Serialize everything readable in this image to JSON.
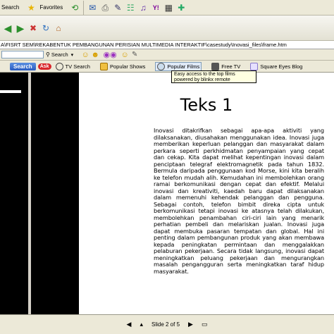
{
  "toolbar": {
    "search_label": "Search",
    "favorites_label": "Favorites"
  },
  "address": {
    "value": "A\\FISRT SEM\\REKABENTUK PEMBANGUNAN PERISIAN MULTIMEDIA INTERAKTIF\\casestudy\\Inovasi_files\\frame.htm"
  },
  "searchbar": {
    "search_label": "Search"
  },
  "linksbar": {
    "search_button": "Search",
    "ask_logo": "Ask",
    "items": [
      {
        "label": "TV Search",
        "icon": "magnifier-tv-icon"
      },
      {
        "label": "Popular Shows",
        "icon": "popular-shows-icon"
      },
      {
        "label": "Popular Films",
        "icon": "globe-icon"
      },
      {
        "label": "Free TV",
        "icon": "free-tv-icon"
      },
      {
        "label": "Square Eyes Blog",
        "icon": "square-eyes-icon"
      }
    ]
  },
  "tooltip": {
    "text": "Easy access to the top films powered by blinkx remote"
  },
  "slide": {
    "title": "Teks 1",
    "body": "Inovasi ditakrifkan sebagai apa-apa aktiviti yang dilaksanakan, diusahakan menggunakan idea. Inovasi juga memberikan keperluan pelanggan dan masyarakat dalam perkara seperti perkhidmatan penyampaian yang cepat dan cekap. Kita dapat melihat kepentingan inovasi dalam penciptaan telegraf elektromagnetik pada tahun 1832. Bermula daripada penggunaan kod Morse, kini kita beralih ke telefon mudah alih. Kemudahan ini membolehkan orang ramai berkomunikasi dengan cepat dan efektif. Melalui inovasi dan kreativiti, kaedah baru dapat dilaksanakan dalam memenuhi kehendak pelanggan dan pengguna. Sebagai contoh, telefon bimbit direka cipta untuk berkomunikasi tetapi inovasi ke atasnya telah dilakukan, membolehkan penambahan ciri-ciri lain yang menarik perhatian pembeli dan melariskan jualan. Inovasi juga dapat membuka pasaran tempatan dan global. Hal ini penting dalam pembangunan produk yang akan membawa kepada peningkatan permintaan dan menggalakkan pelaburan pekerjaan. Secara tidak langsung, inovasi dapat meningkatkan peluang pekerjaan dan mengurangkan masalah pengangguran serta meningkatkan taraf hidup masyarakat."
  },
  "status": {
    "slide_label": "Slide 2 of 5"
  }
}
